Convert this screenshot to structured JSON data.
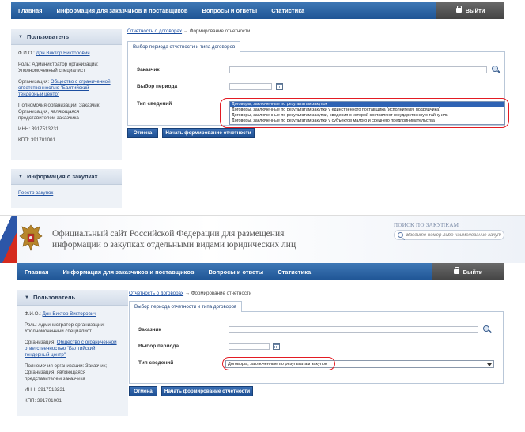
{
  "nav": {
    "items": [
      "Главная",
      "Информация для заказчиков и поставщиков",
      "Вопросы и ответы",
      "Статистика"
    ],
    "logout_label": "Выйти"
  },
  "header": {
    "title_line1": "Официальный сайт Российской Федерации для размещения",
    "title_line2": "информации о закупках отдельными видами юридических лиц",
    "search_title": "ПОИСК ПО ЗАКУПКАМ",
    "search_placeholder": "Введите номер либо наименование закупки"
  },
  "user_panel": {
    "title": "Пользователь",
    "fio_label": "Ф.И.О.:",
    "fio_value": "Дон Виктор Викторович",
    "role": "Роль: Администратор организации; Уполномоченный специалист",
    "org_label": "Организация:",
    "org_value": "Общество с ограниченной ответственностью \"Балтийский тендерный центр\"",
    "powers": "Полномочия организации: Заказчик; Организация, являющаяся представителем заказчика",
    "inn": "ИНН: 3917513231",
    "kpp": "КПП: 391701001"
  },
  "purchases_panel": {
    "title": "Информация о закупках",
    "link": "Реестр закупок"
  },
  "breadcrumb": {
    "link": "Отчетность о договорах",
    "separator": "→",
    "current": "Формирование отчетности"
  },
  "form": {
    "tab_label": "Выбор периода отчетности и типа договоров",
    "customer_label": "Заказчик",
    "period_label": "Выбор периода",
    "type_label": "Тип сведений",
    "options": [
      "Договоры, заключенные по результатам закупок",
      "Договоры, заключенные по результатам закупки у единственного поставщика (исполнителя, подрядчика)",
      "Договоры, заключенные по результатам закупки, сведения о которой составляют государственную тайну или",
      "Договоры, заключенные по результатам закупки у субъектов малого и среднего предпринимательства"
    ],
    "selected_value": "Договоры, заключенные по результатам закупок"
  },
  "buttons": {
    "cancel": "Отмена",
    "start": "Начать формирование отчетности"
  },
  "colors": {
    "nav_blue": "#1f5595",
    "highlight_red": "#e31b23",
    "link_blue": "#1b4ea0"
  }
}
